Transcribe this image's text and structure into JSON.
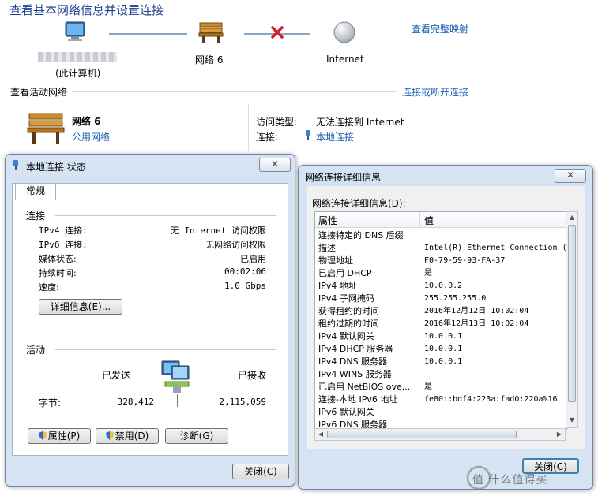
{
  "header": {
    "title": "查看基本网络信息并设置连接",
    "full_map_link": "查看完整映射",
    "computer_label": "(此计算机)",
    "network_label": "网络  6",
    "internet_label": "Internet"
  },
  "active": {
    "heading": "查看活动网络",
    "connect_link": "连接或断开连接",
    "network_name": "网络  6",
    "network_type": "公用网络",
    "access_type_label": "访问类型:",
    "access_type_value": "无法连接到 Internet",
    "connection_label": "连接:",
    "connection_value": "本地连接"
  },
  "status_window": {
    "title": "本地连接 状态",
    "close_glyph": "✕",
    "tab": "常规",
    "connection_section": "连接",
    "rows": [
      {
        "label": "IPv4 连接:",
        "value": "无 Internet 访问权限"
      },
      {
        "label": "IPv6 连接:",
        "value": "无网络访问权限"
      },
      {
        "label": "媒体状态:",
        "value": "已启用"
      },
      {
        "label": "持续时间:",
        "value": "00:02:06"
      },
      {
        "label": "速度:",
        "value": "1.0 Gbps"
      }
    ],
    "details_button": "详细信息(E)...",
    "activity_section": "活动",
    "sent_label": "已发送",
    "received_label": "已接收",
    "bytes_label": "字节:",
    "bytes_sent": "328,412",
    "bytes_received": "2,115,059",
    "properties_button": "属性(P)",
    "disable_button": "禁用(D)",
    "diagnose_button": "诊断(G)",
    "close_button": "关闭(C)"
  },
  "details_window": {
    "title": "网络连接详细信息",
    "close_glyph": "✕",
    "list_label": "网络连接详细信息(D):",
    "col_property": "属性",
    "col_value": "值",
    "rows": [
      {
        "k": "连接特定的 DNS 后缀",
        "v": ""
      },
      {
        "k": "描述",
        "v": "Intel(R) Ethernet Connection ("
      },
      {
        "k": "物理地址",
        "v": "F0-79-59-93-FA-37"
      },
      {
        "k": "已启用 DHCP",
        "v": "是"
      },
      {
        "k": "IPv4 地址",
        "v": "10.0.0.2"
      },
      {
        "k": "IPv4 子网掩码",
        "v": "255.255.255.0"
      },
      {
        "k": "获得租约的时间",
        "v": "2016年12月12日 10:02:04"
      },
      {
        "k": "租约过期的时间",
        "v": "2016年12月13日 10:02:04"
      },
      {
        "k": "IPv4 默认网关",
        "v": "10.0.0.1"
      },
      {
        "k": "IPv4 DHCP 服务器",
        "v": "10.0.0.1"
      },
      {
        "k": "IPv4 DNS 服务器",
        "v": "10.0.0.1"
      },
      {
        "k": "IPv4 WINS 服务器",
        "v": ""
      },
      {
        "k": "已启用 NetBIOS ove...",
        "v": "是"
      },
      {
        "k": "连接-本地 IPv6 地址",
        "v": "fe80::bdf4:223a:fad0:220a%16"
      },
      {
        "k": "IPv6 默认网关",
        "v": ""
      },
      {
        "k": "IPv6 DNS 服务器",
        "v": ""
      }
    ],
    "close_button": "关闭(C)"
  },
  "watermark": {
    "text": "值 什么值得买"
  }
}
